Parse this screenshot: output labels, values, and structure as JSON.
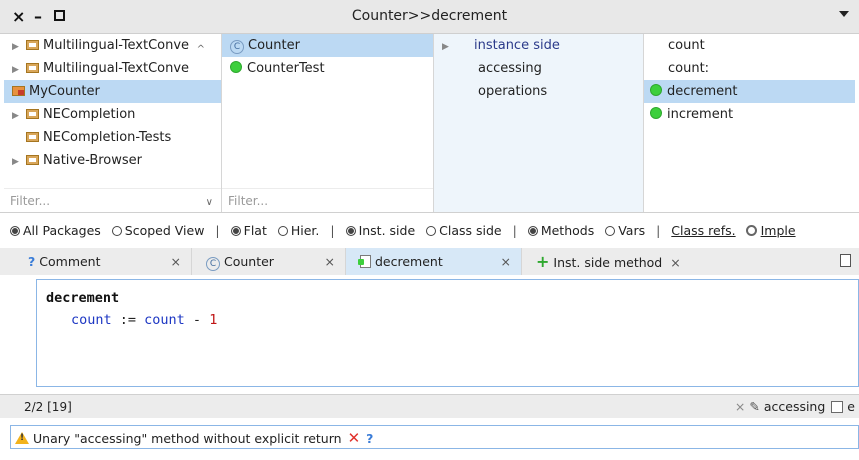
{
  "window": {
    "title": "Counter>>decrement"
  },
  "packages": {
    "items": [
      {
        "label": "Multilingual-TextConve",
        "expandable": true,
        "selected": false
      },
      {
        "label": "Multilingual-TextConve",
        "expandable": true,
        "selected": false
      },
      {
        "label": "MyCounter",
        "expandable": false,
        "selected": true
      },
      {
        "label": "NECompletion",
        "expandable": true,
        "selected": false
      },
      {
        "label": "NECompletion-Tests",
        "expandable": false,
        "selected": false
      },
      {
        "label": "Native-Browser",
        "expandable": true,
        "selected": false
      }
    ],
    "filter_placeholder": "Filter..."
  },
  "classes": {
    "items": [
      {
        "label": "Counter",
        "icon": "class-icon",
        "selected": true
      },
      {
        "label": "CounterTest",
        "icon": "green-dot-icon",
        "selected": false
      }
    ],
    "filter_placeholder": "Filter..."
  },
  "protocols": {
    "items": [
      {
        "label": "instance side"
      },
      {
        "label": "accessing"
      },
      {
        "label": "operations"
      }
    ]
  },
  "methods": {
    "items": [
      {
        "label": "count",
        "icon": "",
        "selected": false
      },
      {
        "label": "count:",
        "icon": "",
        "selected": false
      },
      {
        "label": "decrement",
        "icon": "green-dot-icon",
        "selected": true
      },
      {
        "label": "increment",
        "icon": "green-dot-icon",
        "selected": false
      }
    ]
  },
  "options": {
    "all_packages": "All Packages",
    "scoped_view": "Scoped View",
    "flat": "Flat",
    "hier": "Hier.",
    "inst_side": "Inst. side",
    "class_side": "Class side",
    "methods": "Methods",
    "vars": "Vars",
    "class_refs": "Class refs.",
    "imple": "Imple",
    "sep": "|"
  },
  "tabs": {
    "comment": "Comment",
    "counter": "Counter",
    "decrement": "decrement",
    "inst_side_method": "Inst. side method",
    "close": "×"
  },
  "editor": {
    "selector": "decrement",
    "var1": "count",
    "assign": " := ",
    "var2": "count",
    "minus": " - ",
    "num": "1"
  },
  "status": {
    "position": "2/2 [19]",
    "close": "×",
    "protocol": "accessing",
    "extra": "e"
  },
  "critic": {
    "message": "Unary \"accessing\" method without explicit return",
    "dismiss": "✕",
    "help": "?"
  },
  "colors": {
    "selection": "#bcd9f3",
    "protocol_pane": "#eef5fb",
    "accent_border": "#8bb6e6",
    "green": "#3ccf3c",
    "warning": "#f2b21c",
    "error": "#e0322c"
  }
}
